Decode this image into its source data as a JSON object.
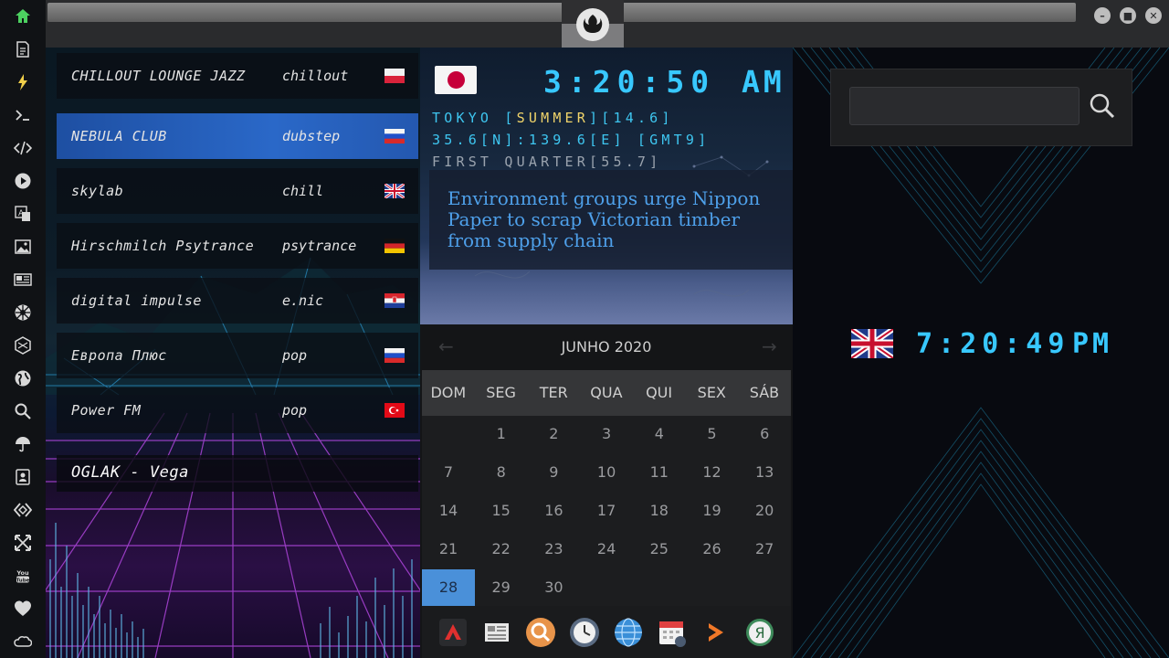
{
  "app": {
    "sidebar_icons": [
      "home-icon",
      "document-icon",
      "bolt-icon",
      "terminal-icon",
      "code-icon",
      "play-icon",
      "translate-icon",
      "image-icon",
      "news-icon",
      "empire-icon",
      "hexagon-icon",
      "globe-icon",
      "search-icon",
      "umbrella-icon",
      "contacts-icon",
      "diamond-code-icon",
      "expand-icon",
      "youtube-icon",
      "heart-icon",
      "cloud-icon"
    ]
  },
  "radio": {
    "stations": [
      {
        "name": "CHILLOUT LOUNGE JAZZ",
        "genre": "chillout",
        "flag": "poland"
      },
      {
        "name": "NEBULA CLUB",
        "genre": "dubstep",
        "flag": "russia"
      },
      {
        "name": "skylab",
        "genre": "chill",
        "flag": "uk"
      },
      {
        "name": "Hirschmilch Psytrance",
        "genre": "psytrance",
        "flag": "germany"
      },
      {
        "name": "digital impulse",
        "genre": "e.nic",
        "flag": "croatia"
      },
      {
        "name": "Европа Плюс",
        "genre": "pop",
        "flag": "russia"
      },
      {
        "name": "Power FM",
        "genre": "pop",
        "flag": "turkey"
      }
    ],
    "now_playing": "OGLAK - Vega"
  },
  "tokyo_clock": {
    "time": "3:20:50",
    "ampm": "AM",
    "city_prefix": "TOKYO [",
    "season": "SUMMER",
    "city_suffix": "][14.6]",
    "coords": "35.6[N]:139.6[E] [GMT9]",
    "moon": "FIRST QUARTER[55.7]"
  },
  "news": {
    "headline": "Environment groups urge Nippon Paper to scrap Victorian timber from supply chain"
  },
  "calendar": {
    "title": "JUNHO 2020",
    "prev": "←",
    "next": "→",
    "day_names": [
      "DOM",
      "SEG",
      "TER",
      "QUA",
      "QUI",
      "SEX",
      "SÁB"
    ],
    "first_weekday": 1,
    "days_in_month": 30,
    "today": "28"
  },
  "dock": {
    "items": [
      "aptana-icon",
      "newspaper-icon",
      "search-app-icon",
      "clock-app-icon",
      "globe-browser-icon",
      "calendar-app-icon",
      "terminal-arrow-icon",
      "yandex-icon"
    ]
  },
  "search": {
    "placeholder": "",
    "value": ""
  },
  "london_clock": {
    "time": "7:20:49",
    "ampm": "PM",
    "flag": "uk"
  },
  "colors": {
    "digital": "#38c8ff",
    "accent": "#4a90d9",
    "highlight": "#f1d46a"
  }
}
